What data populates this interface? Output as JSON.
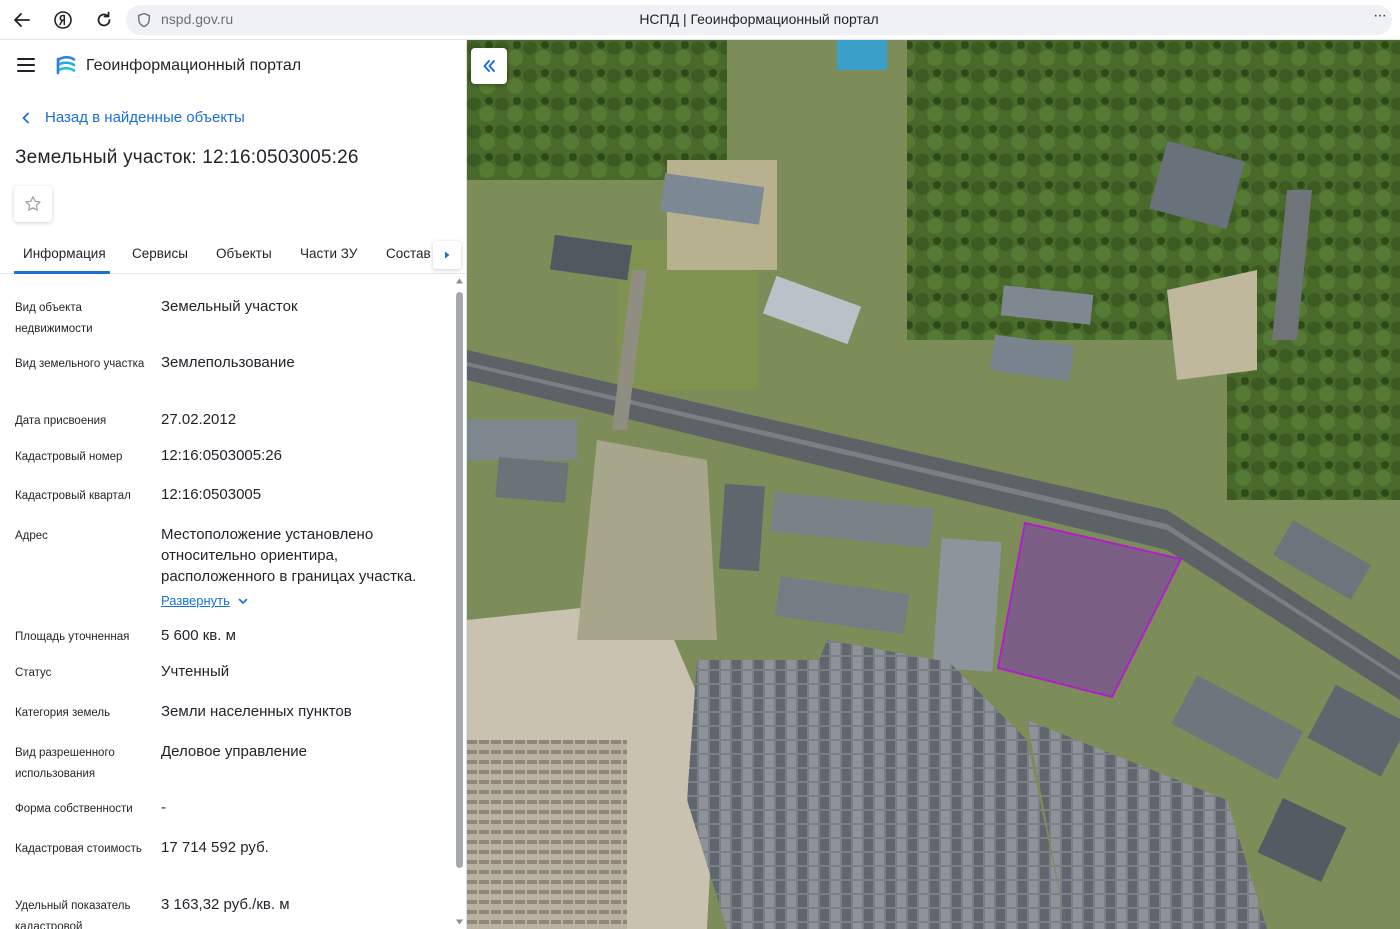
{
  "browser": {
    "url": "nspd.gov.ru",
    "page_title": "НСПД | Геоинформационный портал",
    "more": "···"
  },
  "header": {
    "brand": "Геоинформационный портал"
  },
  "back_link": "Назад в найденные объекты",
  "object_title": "Земельный участок: 12:16:0503005:26",
  "tabs": [
    {
      "label": "Информация",
      "active": true
    },
    {
      "label": "Сервисы",
      "active": false
    },
    {
      "label": "Объекты",
      "active": false
    },
    {
      "label": "Части ЗУ",
      "active": false
    },
    {
      "label": "Состав",
      "active": false
    }
  ],
  "info": [
    {
      "label": "Вид объекта недвижимости",
      "value": "Земельный участок"
    },
    {
      "label": "Вид земельного участка",
      "value": "Землепользование"
    },
    {
      "label": "Дата присвоения",
      "value": "27.02.2012"
    },
    {
      "label": "Кадастровый номер",
      "value": "12:16:0503005:26"
    },
    {
      "label": "Кадастровый квартал",
      "value": "12:16:0503005"
    },
    {
      "label": "Адрес",
      "value": "Местоположение установлено относительно ориентира, расположенного в границах участка.",
      "expand_label": "Развернуть"
    },
    {
      "label": "Площадь уточненная",
      "value": "5 600 кв. м"
    },
    {
      "label": "Статус",
      "value": "Учтенный"
    },
    {
      "label": "Категория земель",
      "value": "Земли населенных пунктов"
    },
    {
      "label": "Вид разрешенного использования",
      "value": "Деловое управление"
    },
    {
      "label": "Форма собственности",
      "value": "-"
    },
    {
      "label": "Кадастровая стоимость",
      "value": "17 714 592 руб."
    },
    {
      "label": "Удельный показатель кадастровой",
      "value": "3 163,32 руб./кв. м"
    }
  ],
  "colors": {
    "accent": "#1a6fd6",
    "parcel_outline": "#b01fc7",
    "parcel_fill": "#7a3aa8"
  }
}
